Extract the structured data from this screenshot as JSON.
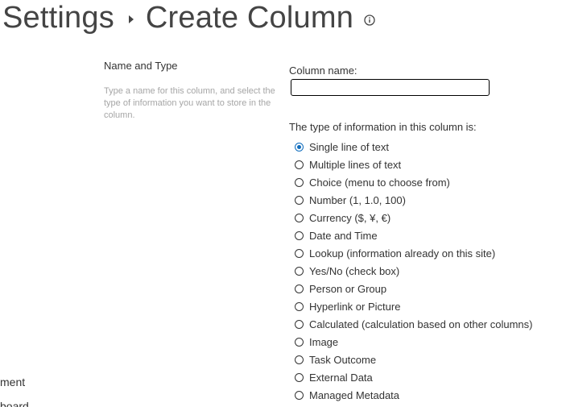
{
  "header": {
    "parent_crumb": "Settings",
    "current_crumb": "Create Column"
  },
  "leftnav": {
    "item_a": "ment",
    "item_b": "board"
  },
  "section": {
    "title": "Name and Type",
    "description": "Type a name for this column, and select the type of information you want to store in the column."
  },
  "form": {
    "column_name_label": "Column name:",
    "column_name_value": "",
    "type_label": "The type of information in this column is:",
    "selected_index": 0,
    "types": [
      {
        "label": "Single line of text"
      },
      {
        "label": "Multiple lines of text"
      },
      {
        "label": "Choice (menu to choose from)"
      },
      {
        "label": "Number (1, 1.0, 100)"
      },
      {
        "label": "Currency ($, ¥, €)"
      },
      {
        "label": "Date and Time"
      },
      {
        "label": "Lookup (information already on this site)"
      },
      {
        "label": "Yes/No (check box)"
      },
      {
        "label": "Person or Group"
      },
      {
        "label": "Hyperlink or Picture"
      },
      {
        "label": "Calculated (calculation based on other columns)"
      },
      {
        "label": "Image"
      },
      {
        "label": "Task Outcome"
      },
      {
        "label": "External Data"
      },
      {
        "label": "Managed Metadata"
      }
    ]
  },
  "icons": {
    "header_info": "info-icon"
  },
  "colors": {
    "accent": "#0f6cbd",
    "description_text": "#a6a6a6"
  }
}
